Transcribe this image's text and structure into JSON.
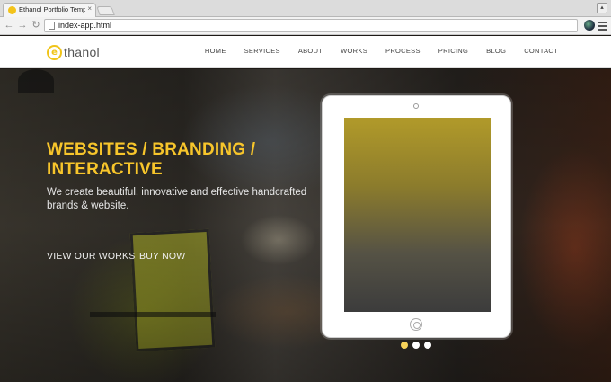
{
  "browser": {
    "tab_title": "Ethanol Portfolio Template",
    "tab_close": "×",
    "url": "index-app.html",
    "back_glyph": "←",
    "forward_glyph": "→",
    "reload_glyph": "↻",
    "window_button_glyph": "▴"
  },
  "site": {
    "logo_mark": "e",
    "logo_text": "thanol",
    "nav": [
      "HOME",
      "SERVICES",
      "ABOUT",
      "WORKS",
      "PROCESS",
      "PRICING",
      "BLOG",
      "CONTACT"
    ]
  },
  "hero": {
    "headline": "WEBSITES / BRANDING / INTERACTIVE",
    "subline": "We create beautiful, innovative and effective handcrafted brands & website.",
    "cta_works": "VIEW OUR WORKS",
    "cta_buy": "BUY NOW",
    "slides_total": 3,
    "slide_active": 1
  },
  "colors": {
    "accent": "#f7c52b",
    "slide_dot_active": "#f7d35a",
    "slide_dot": "#ffffff"
  },
  "icons": {
    "favicon": "ethanol-logo-icon",
    "page": "page-icon",
    "extension": "extension-icon",
    "menu": "hamburger-menu-icon"
  }
}
